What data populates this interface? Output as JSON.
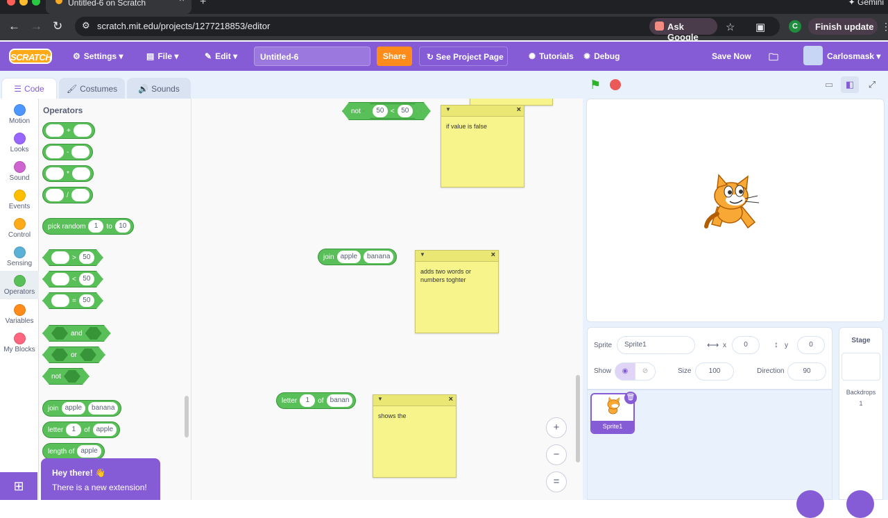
{
  "browser": {
    "tab_title": "Untitled-6 on Scratch",
    "side_label": "Gemini",
    "url": "scratch.mit.edu/projects/1277218853/editor",
    "ask_google": "Ask Google",
    "profile_letter": "C",
    "finish_update": "Finish update"
  },
  "menubar": {
    "logo": "SCRATCH",
    "settings": "Settings",
    "file": "File",
    "edit": "Edit",
    "project_title": "Untitled-6",
    "share": "Share",
    "see_project_page": "See Project Page",
    "tutorials": "Tutorials",
    "debug": "Debug",
    "save_now": "Save Now",
    "username": "Carlosmask"
  },
  "editor_tabs": [
    "Code",
    "Costumes",
    "Sounds"
  ],
  "categories": [
    {
      "label": "Motion",
      "color": "#4c97ff"
    },
    {
      "label": "Looks",
      "color": "#9966ff"
    },
    {
      "label": "Sound",
      "color": "#cf63cf"
    },
    {
      "label": "Events",
      "color": "#ffbf00"
    },
    {
      "label": "Control",
      "color": "#ffab19"
    },
    {
      "label": "Sensing",
      "color": "#5cb1d6"
    },
    {
      "label": "Operators",
      "color": "#59c059"
    },
    {
      "label": "Variables",
      "color": "#ff8c1a"
    },
    {
      "label": "My Blocks",
      "color": "#ff6680"
    }
  ],
  "palette": {
    "title": "Operators",
    "add": "+",
    "subtract": "-",
    "multiply": "*",
    "divide": "/",
    "pick_random": "pick random",
    "random_from": "1",
    "random_to_word": "to",
    "random_to": "10",
    "gt": ">",
    "lt": "<",
    "eq": "=",
    "compare_value": "50",
    "and": "and",
    "or": "or",
    "not": "not",
    "join": "join",
    "join_a": "apple",
    "join_b": "banana",
    "letter": "letter",
    "letter_index": "1",
    "of": "of",
    "letter_word": "apple",
    "length_of": "length of",
    "length_word": "apple"
  },
  "workspace": {
    "not_block": {
      "label": "not",
      "left": "50",
      "op": "<",
      "right": "50"
    },
    "note1": "if value is false",
    "join_block": {
      "label": "join",
      "a": "apple",
      "b": "banana"
    },
    "note2": "adds two words or numbers toghter",
    "letter_block": {
      "label": "letter",
      "index": "1",
      "of": "of",
      "word": "banan"
    },
    "note3": "shows the",
    "zoom_in": "+",
    "zoom_out": "−",
    "zoom_reset": "="
  },
  "sprite_info": {
    "sprite_label": "Sprite",
    "sprite_name": "Sprite1",
    "x_label": "x",
    "x": "0",
    "y_label": "y",
    "y": "0",
    "show_label": "Show",
    "size_label": "Size",
    "size": "100",
    "direction_label": "Direction",
    "direction": "90"
  },
  "sprite_list": {
    "thumb_label": "Sprite1"
  },
  "stage_panel": {
    "title": "Stage",
    "backdrops_label": "Backdrops",
    "backdrops_count": "1"
  },
  "extension_toast": {
    "line1": "Hey there! 👋",
    "line2": "There is a new extension!"
  }
}
